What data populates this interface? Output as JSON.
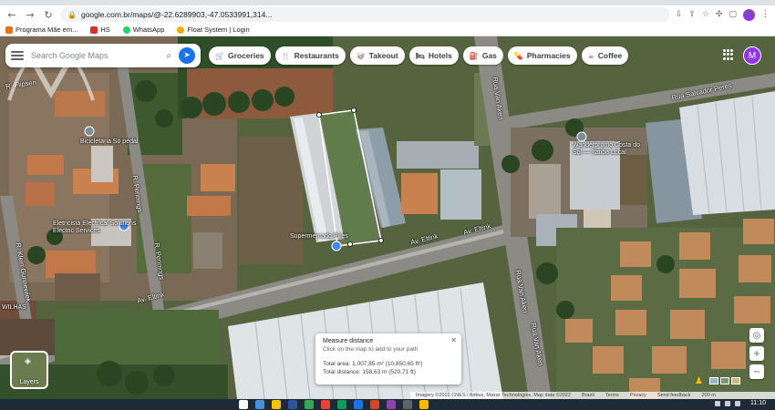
{
  "browser": {
    "url": "google.com.br/maps/@-22.6289903,-47.0533991,314...",
    "profile_initial": "M",
    "bookmarks": [
      {
        "label": "Programa Mãe em...",
        "color": "#e8710a"
      },
      {
        "label": "HS",
        "color": "#d93025"
      },
      {
        "label": "WhatsApp",
        "color": "#25d366"
      },
      {
        "label": "Float System | Login",
        "color": "#f9ab00"
      }
    ]
  },
  "maps": {
    "search_placeholder": "Search Google Maps",
    "chips": [
      {
        "icon": "cart-icon",
        "glyph": "🛒",
        "label": "Groceries"
      },
      {
        "icon": "fork-knife-icon",
        "glyph": "🍴",
        "label": "Restaurants"
      },
      {
        "icon": "takeout-icon",
        "glyph": "🥡",
        "label": "Takeout"
      },
      {
        "icon": "bed-icon",
        "glyph": "🛏",
        "label": "Hotels"
      },
      {
        "icon": "gas-icon",
        "glyph": "⛽",
        "label": "Gas"
      },
      {
        "icon": "pill-icon",
        "glyph": "💊",
        "label": "Pharmacies"
      },
      {
        "icon": "coffee-icon",
        "glyph": "☕",
        "label": "Coffee"
      }
    ],
    "avatar_initial": "M",
    "place_labels": {
      "bicicletaria": "Bicicletaria Só pedal",
      "electric": "Eletricista Electrical Solutions Electric Services",
      "supermercado": "Supermercado Pires",
      "wiilhas": "WILHAS",
      "marketing": "Wanderpromo Costa do Sol — Itatiba Local",
      "peres": "Rua Salvador Peres"
    },
    "road_labels": {
      "r_flipsen": "R. Flipsen",
      "r_pennings_upper": "R. Pennings",
      "r_pennings_lower": "R. Pennings",
      "r_klein": "R. Klein Gunnewiek",
      "av_eltink_left": "Av. Eltink",
      "av_eltink_center": "Av. Eltink",
      "av_eltink_right": "Av. Eltink",
      "rua_van_aken_upper": "Rua Van Aken",
      "rua_van_aken_mid": "Rua Van Aken",
      "rua_van_aken_lower": "Rua Van Aken"
    },
    "measure": {
      "title": "Measure distance",
      "hint": "Click on the map to add to your path",
      "area": "Total area: 1,007,85 m² (10,850,65 ft²)",
      "distance": "Total distance: 158,63 m (520,71 ft)"
    },
    "layers_label": "Layers",
    "attribution": [
      "Imagery ©2022 CNES / Airbus, Maxar Technologies, Map data ©2022",
      "Brazil",
      "Terms",
      "Privacy",
      "Send feedback",
      "200 m"
    ]
  },
  "taskbar": {
    "time": "11:10",
    "app_colors": [
      "#ffffff",
      "#4a90d9",
      "#f4c20d",
      "#2b579a",
      "#34a853",
      "#ea4335",
      "#0f9d58",
      "#1a73e8",
      "#d24726",
      "#8e44ad",
      "#5f6368",
      "#ffb900"
    ]
  }
}
